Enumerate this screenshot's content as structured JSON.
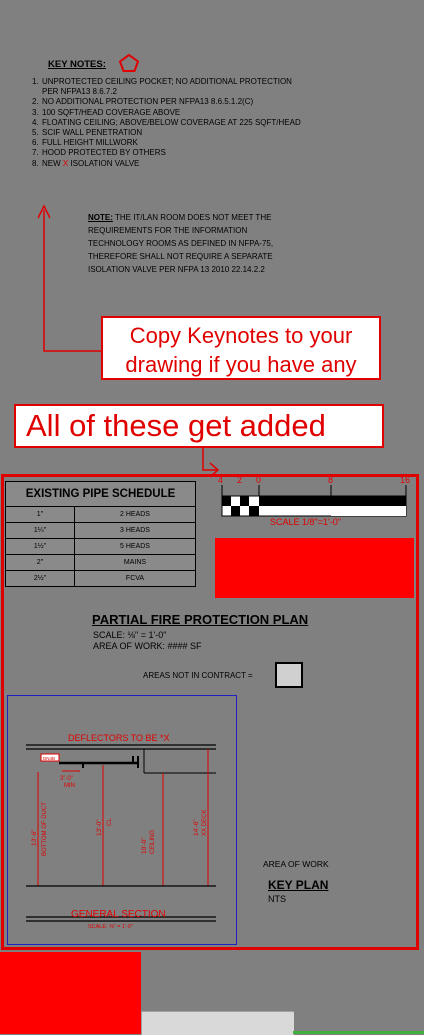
{
  "key_notes": {
    "title": "KEY NOTES:",
    "items": [
      {
        "num": "1.",
        "text": "UNPROTECTED CEILING POCKET; NO ADDITIONAL PROTECTION"
      },
      {
        "num": "",
        "text": "PER NFPA13 8.6.7.2"
      },
      {
        "num": "2.",
        "text": "NO ADDITIONAL PROTECTION PER NFPA13 8.6.5.1.2(C)"
      },
      {
        "num": "3.",
        "text": "100 SQFT/HEAD COVERAGE ABOVE"
      },
      {
        "num": "4.",
        "text": "FLOATING CEILING; ABOVE/BELOW COVERAGE AT 225 SQFT/HEAD"
      },
      {
        "num": "5.",
        "text": "SCIF WALL PENETRATION"
      },
      {
        "num": "6.",
        "text": "FULL HEIGHT MILLWORK"
      },
      {
        "num": "7.",
        "text": "HOOD PROTECTED BY OTHERS"
      }
    ],
    "item8": {
      "num": "8.",
      "pre": "NEW ",
      "x": "X",
      "post": " ISOLATION VALVE"
    }
  },
  "note": {
    "label": "NOTE:",
    "lines": [
      " THE IT/LAN ROOM DOES NOT MEET THE",
      "REQUIREMENTS FOR THE INFORMATION",
      "TECHNOLOGY ROOMS AS DEFINED IN NFPA-75,",
      "THEREFORE SHALL NOT REQUIRE A SEPARATE",
      "ISOLATION VALVE PER NFPA 13 2010 22.14.2.2"
    ]
  },
  "callout": {
    "line1": "Copy Keynotes to your",
    "line2": "drawing if you have any"
  },
  "banner": {
    "text": "All of these get added"
  },
  "pipe_schedule": {
    "title": "EXISTING PIPE SCHEDULE",
    "rows": [
      [
        "1\"",
        "2 HEADS"
      ],
      [
        "1¼\"",
        "3 HEADS"
      ],
      [
        "1½\"",
        "5 HEADS"
      ],
      [
        "2\"",
        "MAINS"
      ],
      [
        "2½\"",
        "FCVA"
      ]
    ]
  },
  "scale_bar": {
    "ticks": [
      "4",
      "2",
      "0",
      "8",
      "16"
    ],
    "label": "SCALE 1/8\"=1'-0\""
  },
  "plan": {
    "title": "PARTIAL FIRE PROTECTION PLAN",
    "scale": "SCALE: ⅛\" = 1'-0\"",
    "area": "AREA OF WORK: #### SF",
    "not_in_contract": "AREAS NOT IN CONTRACT ="
  },
  "section": {
    "deflectors": "DEFLECTORS TO BE *X",
    "dim_min_a": "3\"-0\"",
    "dim_min_b": "MIN",
    "dim1_a": "13'-6\"",
    "dim1_b": "BOTTOM OF DUCT",
    "dim2_a": "13'-0\"",
    "dim2_b": "CL",
    "dim3_a": "10'-0\"",
    "dim3_b": "CEILING",
    "dim4_a": "14'-6\"",
    "dim4_b": "XX DECK",
    "tag": "DN4B",
    "title": "GENERAL SECTION",
    "scale": "SCALE: ⅜\" = 1'-0\""
  },
  "key_plan": {
    "area_of_work": "AREA OF WORK",
    "title": "KEY PLAN",
    "nts": "NTS"
  },
  "colors": {
    "background": "#808080",
    "accent_red": "#e00000",
    "fill_red": "#ff0000"
  }
}
